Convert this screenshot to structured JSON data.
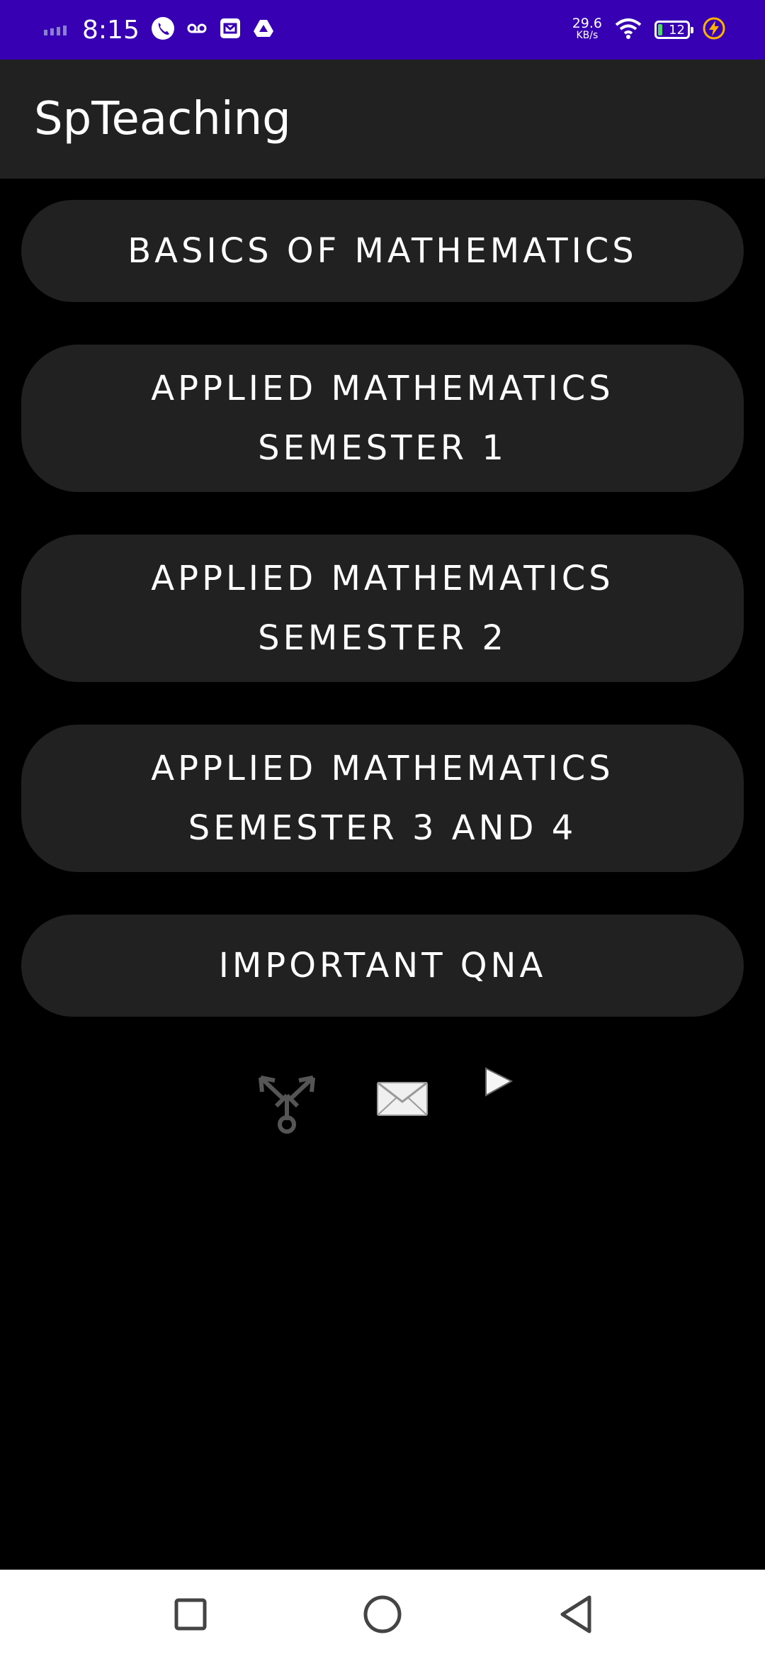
{
  "status_bar": {
    "time": "8:15",
    "net_speed_value": "29.6",
    "net_speed_unit": "KB/s",
    "battery_level": "12",
    "icons": [
      "signal-icon",
      "phone-icon",
      "voicemail-icon",
      "mail-icon",
      "drive-icon",
      "wifi-icon",
      "battery-icon",
      "charging-icon"
    ]
  },
  "app_bar": {
    "title": "SpTeaching"
  },
  "menu": {
    "basics": {
      "line1": "BASICS OF MATHEMATICS"
    },
    "sem1": {
      "line1": "APPLIED MATHEMATICS",
      "line2": "SEMESTER 1"
    },
    "sem2": {
      "line1": "APPLIED MATHEMATICS",
      "line2": "SEMESTER 2"
    },
    "sem34": {
      "line1": "APPLIED MATHEMATICS",
      "line2": "SEMESTER 3 AND 4"
    },
    "qna": {
      "line1": "IMPORTANT QNA"
    }
  },
  "social": {
    "icons": [
      "share-icon",
      "mail-icon",
      "play-icon"
    ]
  },
  "nav_bar": {
    "icons": [
      "recents-icon",
      "home-icon",
      "back-icon"
    ]
  },
  "colors": {
    "status_bar": "#3700B3",
    "app_bar": "#212121",
    "background": "#000000",
    "button": "#212121",
    "text": "#FFFFFF"
  }
}
